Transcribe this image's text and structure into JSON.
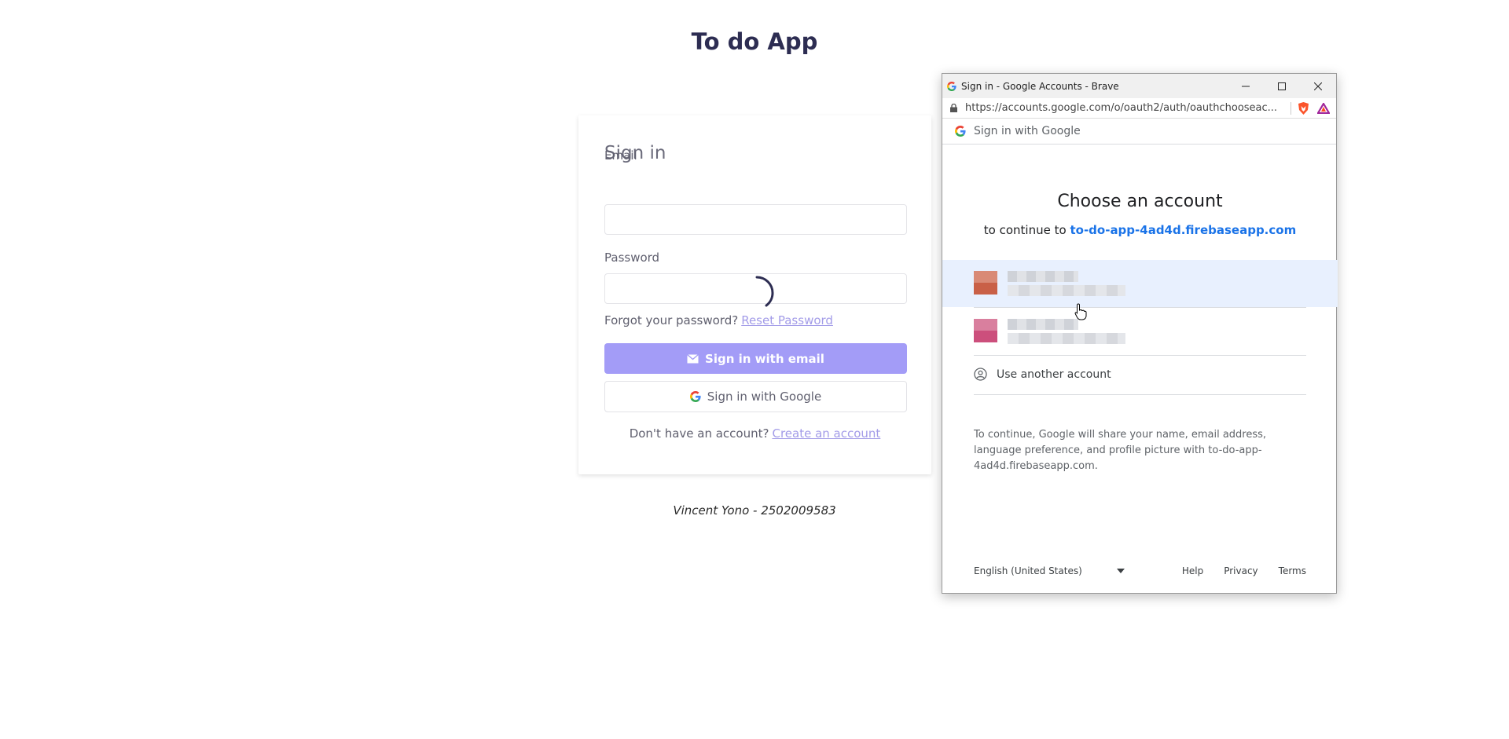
{
  "app": {
    "title": "To do App",
    "footer": "Vincent Yono - 2502009583"
  },
  "signin": {
    "title": "Sign in",
    "email_label": "Email",
    "email_value": "",
    "password_label": "Password",
    "password_value": "",
    "forgot_text": "Forgot your password?",
    "reset_link": "Reset Password",
    "email_button": "Sign in with email",
    "google_button": "Sign in with Google",
    "signup_text": "Don't have an account?",
    "signup_link": "Create an account"
  },
  "popup": {
    "window_title": "Sign in - Google Accounts - Brave",
    "url": "https://accounts.google.com/o/oauth2/auth/oauthchooseac...",
    "header": "Sign in with Google",
    "heading": "Choose an account",
    "continue_text": "to continue to",
    "continue_link": "to-do-app-4ad4d.firebaseapp.com",
    "accounts": [
      {
        "avatar_top": "#d98a76",
        "avatar_bottom": "#c96047"
      },
      {
        "avatar_top": "#d97f9e",
        "avatar_bottom": "#cc4f7c"
      }
    ],
    "use_another": "Use another account",
    "disclaimer": "To continue, Google will share your name, email address, language preference, and profile picture with to-do-app-4ad4d.firebaseapp.com.",
    "language": "English (United States)",
    "footer_links": [
      "Help",
      "Privacy",
      "Terms"
    ]
  },
  "colors": {
    "accent": "#a39cf7",
    "link": "#1a73e8",
    "title": "#2d2d52"
  }
}
